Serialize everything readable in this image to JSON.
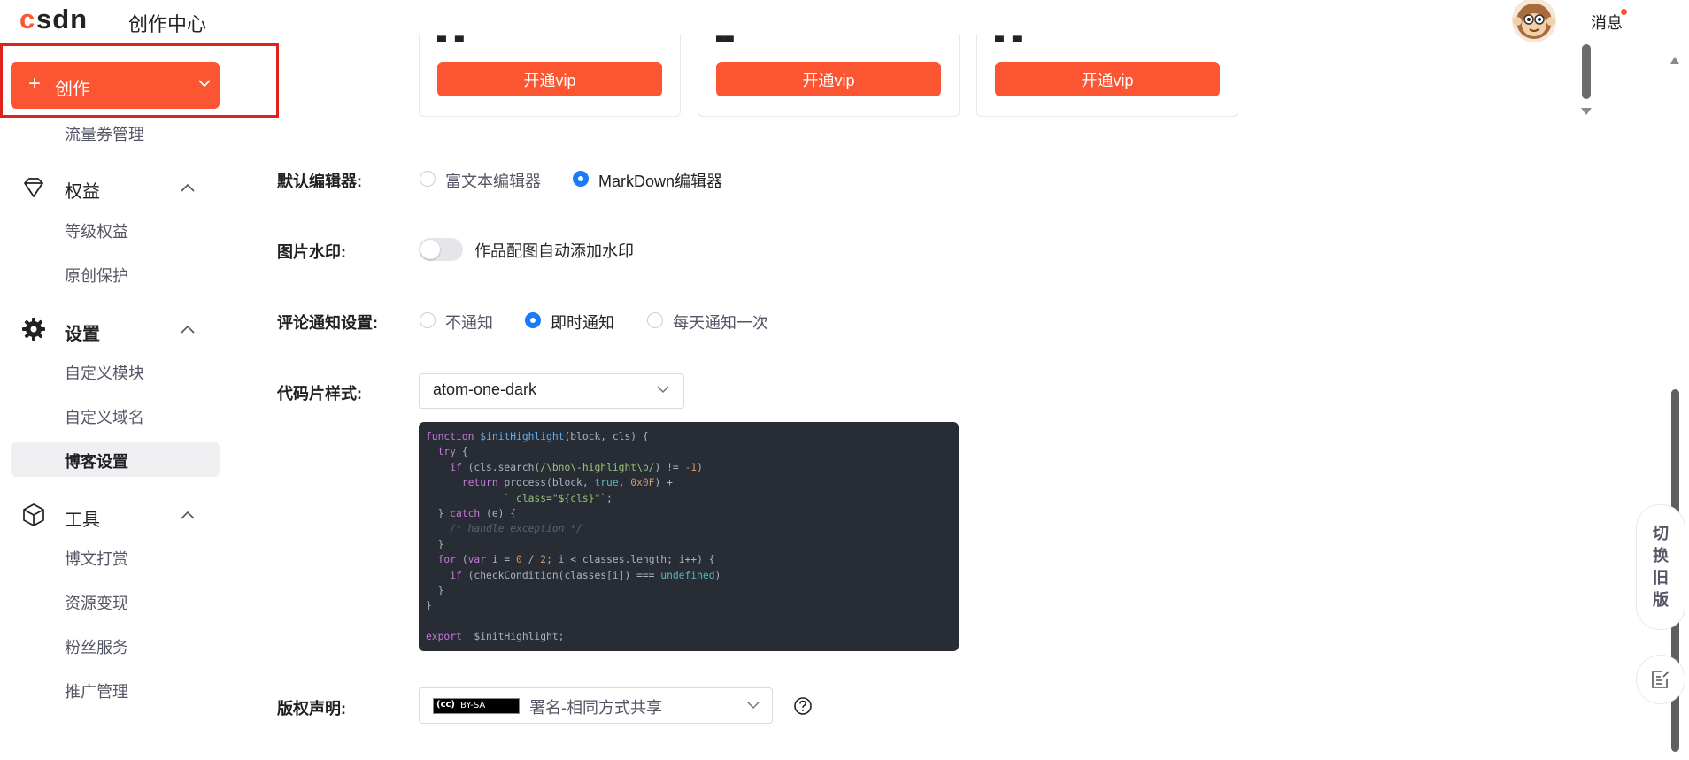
{
  "header": {
    "logo": "CSDN",
    "title": "创作中心",
    "messages_label": "消息"
  },
  "sidebar": {
    "create_label": "创作",
    "items": [
      {
        "label": "流量券管理",
        "type": "sub"
      },
      {
        "label": "权益",
        "type": "group",
        "icon": "diamond-icon"
      },
      {
        "label": "等级权益",
        "type": "sub"
      },
      {
        "label": "原创保护",
        "type": "sub"
      },
      {
        "label": "设置",
        "type": "group",
        "icon": "gear-icon"
      },
      {
        "label": "自定义模块",
        "type": "sub"
      },
      {
        "label": "自定义域名",
        "type": "sub"
      },
      {
        "label": "博客设置",
        "type": "sub",
        "active": true
      },
      {
        "label": "工具",
        "type": "group",
        "icon": "cube-icon"
      },
      {
        "label": "博文打赏",
        "type": "sub"
      },
      {
        "label": "资源变现",
        "type": "sub"
      },
      {
        "label": "粉丝服务",
        "type": "sub"
      },
      {
        "label": "推广管理",
        "type": "sub"
      }
    ]
  },
  "vip_cards": [
    {
      "button": "开通vip"
    },
    {
      "button": "开通vip"
    },
    {
      "button": "开通vip"
    }
  ],
  "settings": {
    "editor": {
      "label": "默认编辑器:",
      "options": [
        "富文本编辑器",
        "MarkDown编辑器"
      ],
      "selected": "MarkDown编辑器"
    },
    "watermark": {
      "label": "图片水印:",
      "toggle_text": "作品配图自动添加水印",
      "enabled": false
    },
    "comment_notify": {
      "label": "评论通知设置:",
      "options": [
        "不通知",
        "即时通知",
        "每天通知一次"
      ],
      "selected": "即时通知"
    },
    "code_style": {
      "label": "代码片样式:",
      "value": "atom-one-dark"
    },
    "copyright": {
      "label": "版权声明:",
      "badge": "BY-SA",
      "value": "署名-相同方式共享"
    }
  },
  "float_buttons": {
    "switch_old": "切换旧版"
  },
  "colors": {
    "brand": "#fc5531",
    "radio_active": "#1a7af8",
    "code_bg": "#282c34"
  }
}
